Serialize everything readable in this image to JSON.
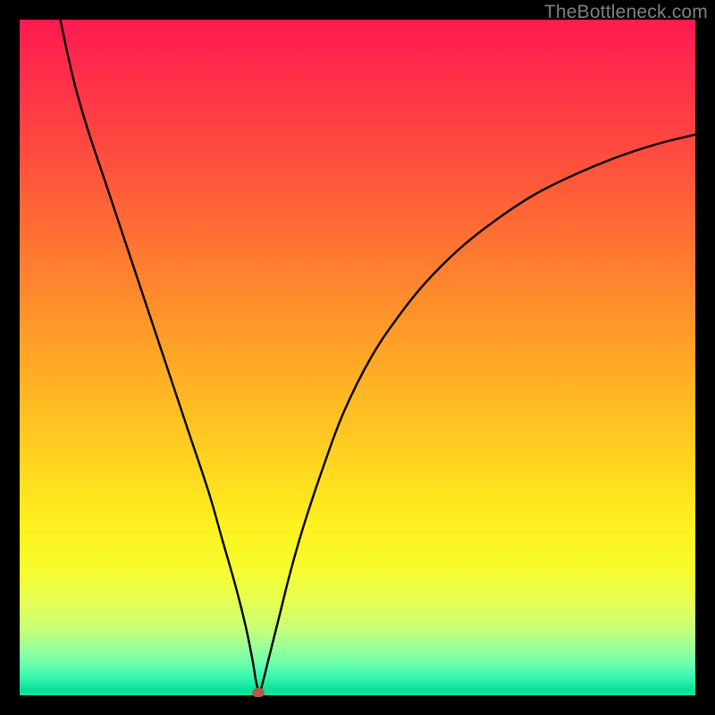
{
  "watermark": "TheBottleneck.com",
  "chart_data": {
    "type": "line",
    "title": "",
    "xlabel": "",
    "ylabel": "",
    "xlim": [
      0,
      100
    ],
    "ylim": [
      0,
      100
    ],
    "grid": false,
    "legend": false,
    "series": [
      {
        "name": "curve",
        "x": [
          6,
          8,
          10,
          13,
          16,
          19,
          22,
          25,
          28,
          30,
          32,
          33.5,
          34.5,
          35,
          35.5,
          36,
          37,
          38.5,
          40,
          42,
          45,
          48,
          52,
          56,
          60,
          65,
          70,
          76,
          82,
          88,
          94,
          100
        ],
        "values": [
          100,
          91,
          84,
          75,
          66,
          57,
          48,
          39,
          30,
          23,
          16,
          10,
          5,
          2,
          0.5,
          2,
          6,
          12,
          18,
          25,
          34,
          42,
          50,
          56,
          61,
          66,
          70,
          74,
          77,
          79.5,
          81.5,
          83
        ]
      }
    ],
    "min_marker": {
      "x": 35.3,
      "y": 0.4
    },
    "gradient_note": "vertical gradient red→orange→yellow→green top-to-bottom"
  }
}
